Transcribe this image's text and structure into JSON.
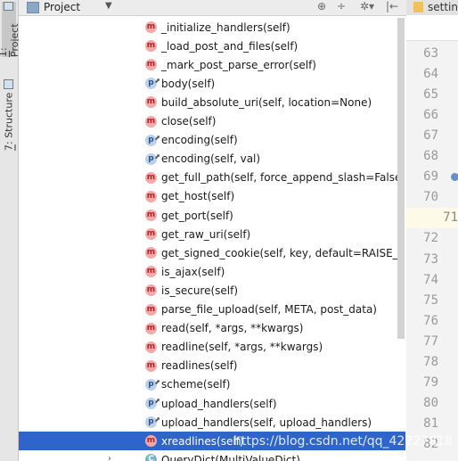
{
  "side_tabs": [
    {
      "num": "1",
      "label": ": Project",
      "active": true
    },
    {
      "num": "7",
      "label": ": Structure",
      "active": false
    }
  ],
  "header": {
    "title": "Project",
    "dropdown": "▼",
    "icons": [
      "globe-icon",
      "split-icon",
      "gear-icon",
      "collapse-icon"
    ],
    "icon_glyphs": [
      "⊕",
      "÷",
      "✲▾",
      "|←"
    ]
  },
  "members": [
    {
      "badge": "m",
      "label": "_initialize_handlers(self)"
    },
    {
      "badge": "m",
      "label": "_load_post_and_files(self)"
    },
    {
      "badge": "m",
      "label": "_mark_post_parse_error(self)"
    },
    {
      "badge": "p",
      "label": "body(self)"
    },
    {
      "badge": "m",
      "label": "build_absolute_uri(self, location=None)"
    },
    {
      "badge": "m",
      "label": "close(self)"
    },
    {
      "badge": "p",
      "label": "encoding(self)"
    },
    {
      "badge": "p",
      "label": "encoding(self, val)"
    },
    {
      "badge": "m",
      "label": "get_full_path(self, force_append_slash=False)"
    },
    {
      "badge": "m",
      "label": "get_host(self)"
    },
    {
      "badge": "m",
      "label": "get_port(self)"
    },
    {
      "badge": "m",
      "label": "get_raw_uri(self)"
    },
    {
      "badge": "m",
      "label": "get_signed_cookie(self, key, default=RAISE_ERR"
    },
    {
      "badge": "m",
      "label": "is_ajax(self)"
    },
    {
      "badge": "m",
      "label": "is_secure(self)"
    },
    {
      "badge": "m",
      "label": "parse_file_upload(self, META, post_data)"
    },
    {
      "badge": "m",
      "label": "read(self, *args, **kwargs)"
    },
    {
      "badge": "m",
      "label": "readline(self, *args, **kwargs)"
    },
    {
      "badge": "m",
      "label": "readlines(self)"
    },
    {
      "badge": "p",
      "label": "scheme(self)"
    },
    {
      "badge": "p",
      "label": "upload_handlers(self)"
    },
    {
      "badge": "p",
      "label": "upload_handlers(self, upload_handlers)"
    },
    {
      "badge": "m",
      "label": "xreadlines(self)"
    }
  ],
  "selected_member_index": 22,
  "next_class": {
    "badge": "C",
    "label": "QueryDict(MultiValueDict)",
    "arrow": "›"
  },
  "editor": {
    "tab_label": "settin",
    "line_numbers": [
      "63",
      "64",
      "65",
      "66",
      "67",
      "68",
      "69",
      "70",
      "71",
      "72",
      "73",
      "74",
      "75",
      "76",
      "77",
      "78",
      "79",
      "80",
      "81",
      "82"
    ],
    "current_line": "71",
    "breakpoint_line": "69"
  },
  "watermark": "https://blog.csdn.net/qq_42227818"
}
